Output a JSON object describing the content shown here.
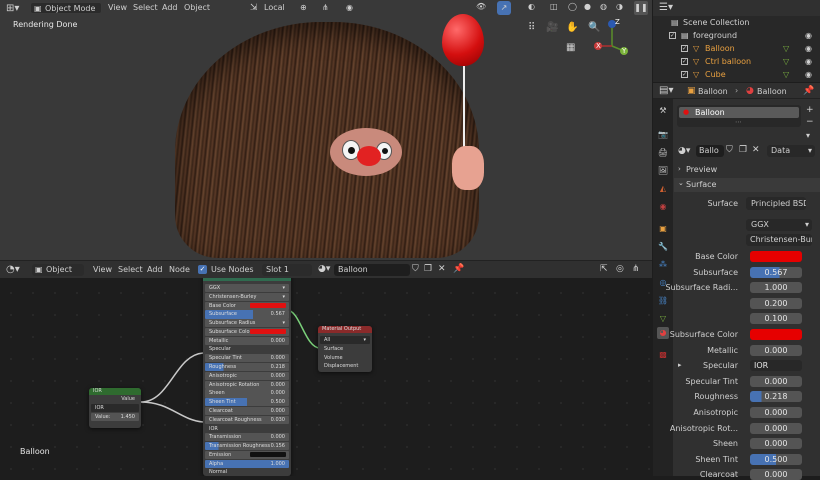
{
  "viewport": {
    "mode_label": "Object Mode",
    "menu": [
      "View",
      "Select",
      "Add",
      "Object"
    ],
    "transform_orientation": "Local",
    "status_text": "Rendering Done",
    "gizmo": {
      "x": "X",
      "y": "Y",
      "z": "Z"
    }
  },
  "node_editor": {
    "editor_type_label": "Object",
    "menu": [
      "View",
      "Select",
      "Add",
      "Node"
    ],
    "use_nodes_label": "Use Nodes",
    "slot_label": "Slot 1",
    "material_name": "Balloon",
    "corner_label": "Balloon",
    "bsdf_node": {
      "title": "BSDF",
      "distribution": "GGX",
      "subsurface_method": "Christensen-Burley",
      "rows": [
        {
          "label": "Base Color",
          "value": "",
          "swatch": "#e01010"
        },
        {
          "label": "Subsurface",
          "value": "0.567",
          "fill": 0.57
        },
        {
          "label": "Subsurface Radius",
          "value": "",
          "dropdown": true
        },
        {
          "label": "Subsurface Color",
          "value": "",
          "swatch": "#e01010"
        },
        {
          "label": "Metallic",
          "value": "0.000"
        },
        {
          "label": "Specular",
          "value": "",
          "plain": true
        },
        {
          "label": "Specular Tint",
          "value": "0.000"
        },
        {
          "label": "Roughness",
          "value": "0.218",
          "fill": 0.22
        },
        {
          "label": "Anisotropic",
          "value": "0.000"
        },
        {
          "label": "Anisotropic Rotation",
          "value": "0.000"
        },
        {
          "label": "Sheen",
          "value": "0.000"
        },
        {
          "label": "Sheen Tint",
          "value": "0.500",
          "fill": 0.5
        },
        {
          "label": "Clearcoat",
          "value": "0.000"
        },
        {
          "label": "Clearcoat Roughness",
          "value": "0.030"
        },
        {
          "label": "IOR",
          "value": "",
          "plain": true
        },
        {
          "label": "Transmission",
          "value": "0.000"
        },
        {
          "label": "Transmission Roughness",
          "value": "0.156",
          "fill": 0.16
        },
        {
          "label": "Emission",
          "value": "",
          "swatch": "#111111"
        },
        {
          "label": "Alpha",
          "value": "1.000",
          "fill": 1.0
        },
        {
          "label": "Normal",
          "value": "",
          "plain": true
        },
        {
          "label": "Clearcoat Normal",
          "value": "",
          "plain": true
        }
      ]
    },
    "output_node": {
      "title": "Material Output",
      "target": "All",
      "sockets": [
        "Surface",
        "Volume",
        "Displacement"
      ]
    },
    "ior_node": {
      "title": "IOR",
      "output": "Value",
      "name_field": "IOR",
      "value_label": "Value:",
      "value": "1.450"
    }
  },
  "outliner": {
    "title": "Scene Collection",
    "items": [
      {
        "name": "foreground",
        "indent": 1,
        "color": "#d0d0d0",
        "checked": true
      },
      {
        "name": "Balloon",
        "indent": 2,
        "color": "#e8a040",
        "checked": true
      },
      {
        "name": "Ctrl balloon",
        "indent": 2,
        "color": "#e8a040",
        "checked": true
      },
      {
        "name": "Cube",
        "indent": 2,
        "color": "#e8a040",
        "checked": true
      }
    ]
  },
  "properties": {
    "object_name": "Balloon",
    "material_name": "Balloon",
    "slot_item": "Balloon",
    "datablock_name": "Ballo",
    "link_type": "Data",
    "sections": {
      "preview": "Preview",
      "surface": "Surface"
    },
    "surface_shader": "Principled BSDF",
    "distribution": "GGX",
    "subsurface_method": "Christensen-Bur...",
    "rows": [
      {
        "label": "Base Color",
        "kind": "color",
        "color": "#e60000"
      },
      {
        "label": "Subsurface",
        "kind": "fill",
        "value": "0.567",
        "fill": 0.567
      },
      {
        "label": "Subsurface Radi...",
        "kind": "text",
        "value": "1.000"
      },
      {
        "label": "",
        "kind": "text",
        "value": "0.200"
      },
      {
        "label": "",
        "kind": "text",
        "value": "0.100"
      },
      {
        "label": "Subsurface Color",
        "kind": "color",
        "color": "#e60000"
      },
      {
        "label": "Metallic",
        "kind": "text",
        "value": "0.000"
      },
      {
        "label": "Specular",
        "kind": "link",
        "value": "IOR"
      },
      {
        "label": "Specular Tint",
        "kind": "text",
        "value": "0.000"
      },
      {
        "label": "Roughness",
        "kind": "fill",
        "value": "0.218",
        "fill": 0.218
      },
      {
        "label": "Anisotropic",
        "kind": "text",
        "value": "0.000"
      },
      {
        "label": "Anisotropic Rot...",
        "kind": "text",
        "value": "0.000"
      },
      {
        "label": "Sheen",
        "kind": "text",
        "value": "0.000"
      },
      {
        "label": "Sheen Tint",
        "kind": "fill",
        "value": "0.500",
        "fill": 0.5
      },
      {
        "label": "Clearcoat",
        "kind": "text",
        "value": "0.000"
      }
    ]
  },
  "colors": {
    "accent": "#4772b3",
    "material_red": "#e60000",
    "output_header": "#8a2a2a",
    "ior_header": "#2f6b2f",
    "orange": "#e8a040"
  }
}
